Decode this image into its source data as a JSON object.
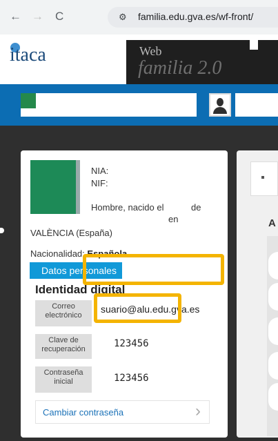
{
  "browser": {
    "back_icon": "←",
    "forward_icon": "→",
    "reload_icon": "C",
    "site_info_icon": "⚙",
    "url": "familia.edu.gva.es/wf-front/"
  },
  "header": {
    "logo_text": "itaca",
    "banner_web": "Web",
    "banner_title": "familia 2.0"
  },
  "profile": {
    "nia_label": "NIA:",
    "nif_label": "NIF:",
    "gender_text": "Hombre, nacido el",
    "gender_text_2": "de",
    "gender_text_en": "en",
    "city": "VALÈNCIA (España)",
    "nationality_label": "Nacionalidad:",
    "nationality_value": "Española"
  },
  "tab": {
    "label": "Datos personales"
  },
  "identity": {
    "title": "Identidad digital",
    "email_label": "Correo electrónico",
    "email_value": "suario@alu.edu.gva.es",
    "recovery_label": "Clave de recuperación",
    "recovery_value": "123456",
    "password_label": "Contraseña inicial",
    "password_value": "123456",
    "change_password": "Cambiar contraseña",
    "chevron_icon": "›"
  },
  "right_panel": {
    "letter": "A"
  },
  "colors": {
    "blue_band": "#0c6db3",
    "tab_blue": "#1199d8",
    "highlight": "#f4b400",
    "photo_green": "#1d8a57"
  }
}
